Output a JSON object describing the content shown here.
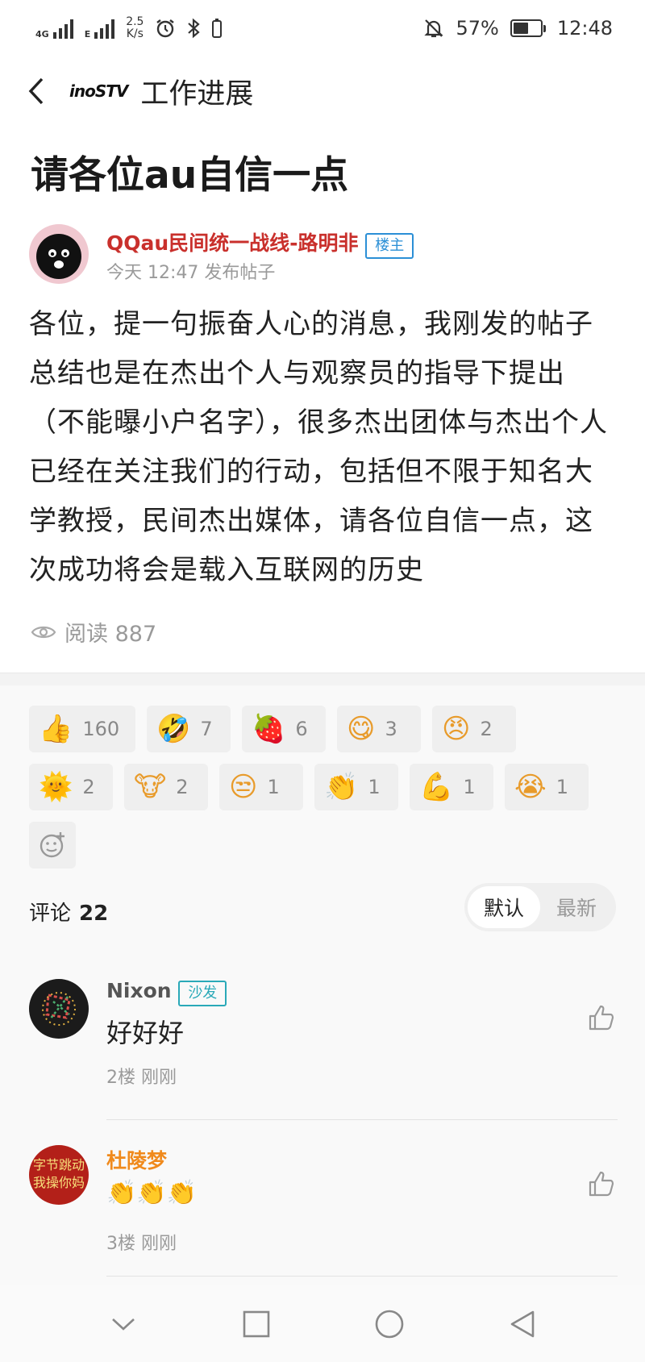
{
  "status_bar": {
    "signal1_label": "4G",
    "signal2_label": "E",
    "speed_value": "2.5",
    "speed_unit": "K/s",
    "battery_percent": "57%",
    "battery_level": 0.57,
    "time": "12:48"
  },
  "nav": {
    "logo_text": "inoSTV",
    "title": "工作进展"
  },
  "post": {
    "title": "请各位au自信一点",
    "author": "QQau民间统一战线-路明非",
    "author_badge": "楼主",
    "meta": "今天 12:47 发布帖子",
    "body": "各位，提一句振奋人心的消息，我刚发的帖子总结也是在杰出个人与观察员的指导下提出（不能曝小户名字），很多杰出团体与杰出个人已经在关注我们的行动，包括但不限于知名大学教授，民间杰出媒体，请各位自信一点，这次成功将会是载入互联网的历史",
    "reads": "阅读 887"
  },
  "reactions": [
    {
      "icon": "thumbs-up-emoji",
      "glyph": "👍",
      "count": "160"
    },
    {
      "icon": "laughing-emoji",
      "glyph": "🤣",
      "count": "7"
    },
    {
      "icon": "strawberry-emoji",
      "glyph": "🍓",
      "count": "6"
    },
    {
      "icon": "yum-emoji",
      "glyph": "😋",
      "count": "3"
    },
    {
      "icon": "determined-emoji",
      "glyph": "😠",
      "count": "2"
    },
    {
      "icon": "sun-emoji",
      "glyph": "🌞",
      "count": "2"
    },
    {
      "icon": "cow-emoji",
      "glyph": "🐮",
      "count": "2"
    },
    {
      "icon": "unamused-emoji",
      "glyph": "😒",
      "count": "1"
    },
    {
      "icon": "clap-emoji",
      "glyph": "👏",
      "count": "1"
    },
    {
      "icon": "muscle-emoji",
      "glyph": "💪",
      "count": "1"
    },
    {
      "icon": "crying-emoji",
      "glyph": "😭",
      "count": "1"
    }
  ],
  "comments_header": {
    "label": "评论",
    "count": "22",
    "sort_default": "默认",
    "sort_newest": "最新"
  },
  "comments": [
    {
      "name": "Nixon",
      "badge": "沙发",
      "text": "好好好",
      "meta": "2楼 刚刚",
      "name_color": "#555555"
    },
    {
      "name": "杜陵梦",
      "text": "👏👏👏",
      "meta": "3楼 刚刚",
      "name_color": "#f08a1c"
    }
  ],
  "avatar2_text": "字节跳动我操你妈"
}
